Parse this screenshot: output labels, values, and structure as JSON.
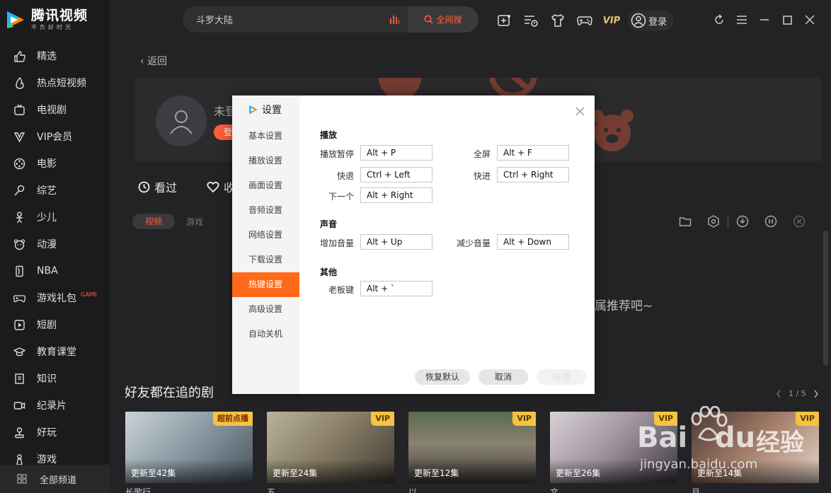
{
  "app": {
    "name": "腾讯视频",
    "slogan": "不负好时光"
  },
  "sidebar": {
    "items": [
      {
        "label": "精选",
        "icon": "thumbs-up-icon"
      },
      {
        "label": "热点短视频",
        "icon": "flame-icon"
      },
      {
        "label": "电视剧",
        "icon": "tv-icon"
      },
      {
        "label": "VIP会员",
        "icon": "vip-icon"
      },
      {
        "label": "电影",
        "icon": "film-reel-icon"
      },
      {
        "label": "综艺",
        "icon": "microphone-icon"
      },
      {
        "label": "少儿",
        "icon": "child-icon"
      },
      {
        "label": "动漫",
        "icon": "bear-face-icon"
      },
      {
        "label": "NBA",
        "icon": "nba-icon"
      },
      {
        "label": "游戏礼包",
        "icon": "gamepad-icon",
        "tag": "GAME"
      },
      {
        "label": "短剧",
        "icon": "play-square-icon"
      },
      {
        "label": "教育课堂",
        "icon": "graduation-cap-icon"
      },
      {
        "label": "知识",
        "icon": "book-icon"
      },
      {
        "label": "纪录片",
        "icon": "camera-icon"
      },
      {
        "label": "好玩",
        "icon": "joystick-icon"
      },
      {
        "label": "游戏",
        "icon": "game-icon"
      }
    ],
    "all_channels": "全部频道"
  },
  "topbar": {
    "search_value": "斗罗大陆",
    "search_button": "全网搜",
    "vip": "VIP",
    "login": "登录"
  },
  "main": {
    "back": "返回",
    "not_logged": "未登",
    "login_pill": "登",
    "tabs": [
      "看过",
      "收"
    ],
    "chips": [
      "视频",
      "游戏"
    ],
    "empty_tip": "属推荐吧~",
    "friends_title": "好友都在追的剧",
    "pager": "1 / 5",
    "cards": [
      {
        "badge": "超前点播",
        "episodes": "更新至42集",
        "title": "长歌行",
        "badge_color": "#f5c242"
      },
      {
        "badge": "VIP",
        "episodes": "更新至24集",
        "title": "五",
        "badge_color": "#f5c242"
      },
      {
        "badge": "VIP",
        "episodes": "更新至12集",
        "title": "以",
        "badge_color": "#f5c242"
      },
      {
        "badge": "VIP",
        "episodes": "更新至26集",
        "title": "文",
        "badge_color": "#f5c242"
      },
      {
        "badge": "VIP",
        "episodes": "更新至14集",
        "title": "月",
        "badge_color": "#f5c242"
      }
    ]
  },
  "settings": {
    "title": "设置",
    "nav": [
      "基本设置",
      "播放设置",
      "画面设置",
      "音频设置",
      "网络设置",
      "下载设置",
      "热键设置",
      "高级设置",
      "自动关机"
    ],
    "active_index": 6,
    "sections": {
      "play": {
        "title": "播放",
        "play_pause_label": "播放暂停",
        "play_pause": "Alt + P",
        "fullscreen_label": "全屏",
        "fullscreen": "Alt + F",
        "rewind_label": "快退",
        "rewind": "Ctrl + Left",
        "forward_label": "快进",
        "forward": "Ctrl + Right",
        "next_label": "下一个",
        "next": "Alt + Right"
      },
      "sound": {
        "title": "声音",
        "vol_up_label": "增加音量",
        "vol_up": "Alt + Up",
        "vol_down_label": "减少音量",
        "vol_down": "Alt + Down"
      },
      "other": {
        "title": "其他",
        "boss_key_label": "老板键",
        "boss_key": "Alt + `"
      }
    },
    "buttons": {
      "restore": "恢复默认",
      "cancel": "取消",
      "apply": "应用"
    }
  },
  "watermark": {
    "brand": "Bai",
    "du": "du",
    "jingyan": "经验",
    "url": "jingyan.baidu.com"
  },
  "colors": {
    "accent": "#ff5c38",
    "sidebar_bg": "#1b1b1d",
    "main_bg": "#232326",
    "modal_active": "#ff6a1a",
    "vip_gold": "#e7c27a"
  }
}
